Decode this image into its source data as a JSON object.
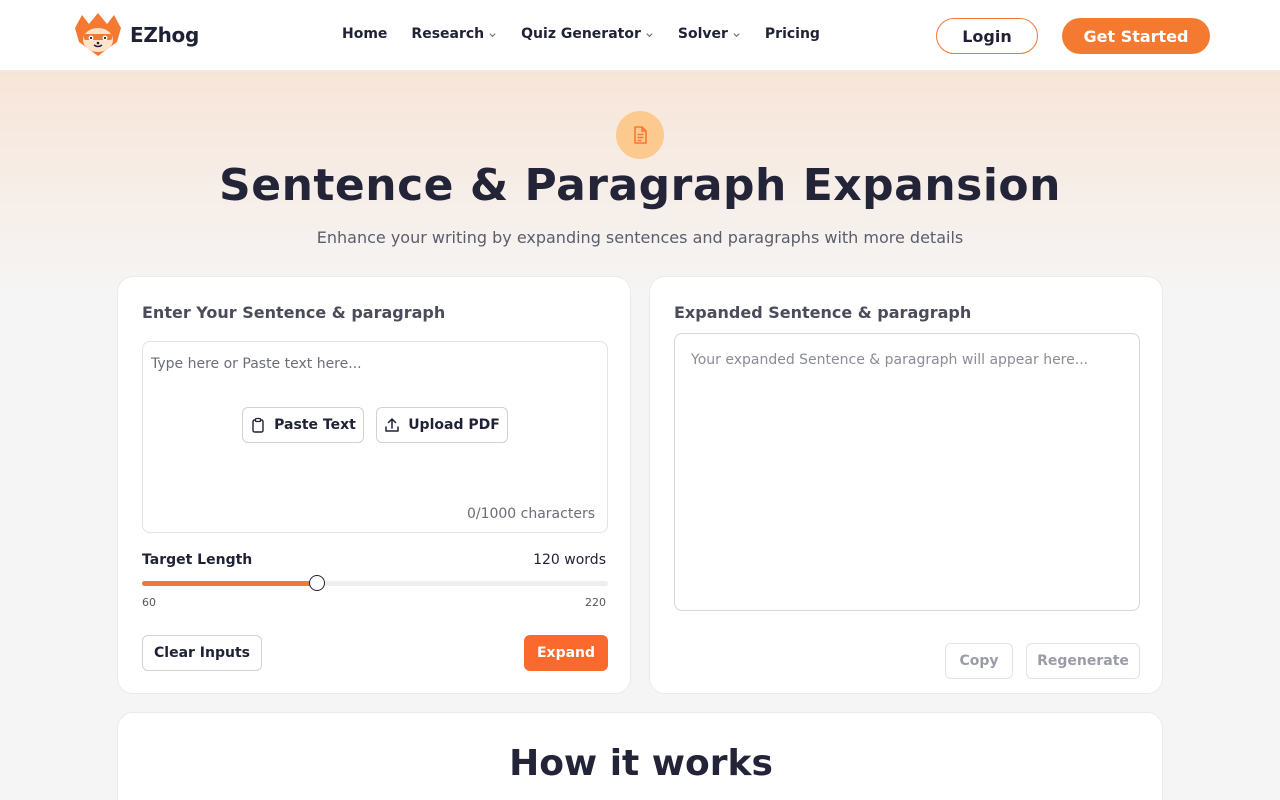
{
  "brand": {
    "name": "EZhog",
    "accent_color": "#f47a32"
  },
  "nav": {
    "items": [
      {
        "label": "Home",
        "has_dropdown": false
      },
      {
        "label": "Research",
        "has_dropdown": true
      },
      {
        "label": "Quiz Generator",
        "has_dropdown": true
      },
      {
        "label": "Solver",
        "has_dropdown": true
      },
      {
        "label": "Pricing",
        "has_dropdown": false
      }
    ],
    "login_label": "Login",
    "get_started_label": "Get Started"
  },
  "hero": {
    "icon": "document-icon",
    "title": "Sentence & Paragraph Expansion",
    "subtitle": "Enhance your writing by expanding sentences and paragraphs with more details"
  },
  "input_panel": {
    "title": "Enter Your Sentence & paragraph",
    "placeholder": "Type here or Paste text here...",
    "paste_label": "Paste Text",
    "upload_label": "Upload PDF",
    "char_count": "0/1000 characters",
    "target_length_label": "Target Length",
    "target_length_value": "120 words",
    "slider": {
      "min": 60,
      "max": 220,
      "value": 120,
      "min_label": "60",
      "max_label": "220"
    },
    "clear_label": "Clear Inputs",
    "expand_label": "Expand"
  },
  "output_panel": {
    "title": "Expanded Sentence & paragraph",
    "placeholder": "Your expanded Sentence & paragraph will appear here...",
    "copy_label": "Copy",
    "regenerate_label": "Regenerate"
  },
  "how_it_works": {
    "title": "How it works"
  }
}
